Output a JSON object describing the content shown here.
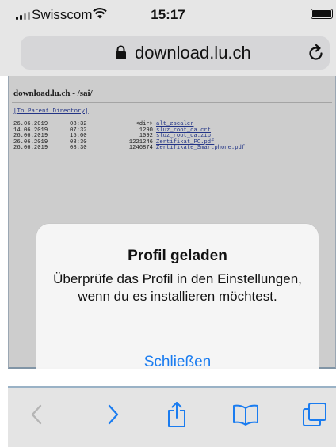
{
  "status_bar": {
    "carrier": "Swisscom",
    "time": "15:17",
    "icons": [
      "signal-icon",
      "wifi-icon",
      "battery-icon"
    ]
  },
  "url_bar": {
    "domain": "download.lu.ch",
    "icons": [
      "lock-icon",
      "reload-icon"
    ]
  },
  "page": {
    "heading": "download.lu.ch - /sai/",
    "parent_link": "[To Parent Directory]",
    "entries": [
      {
        "date": "26.06.2019",
        "time": "08:32",
        "size": "<dir>",
        "name": "alt_zscaler"
      },
      {
        "date": "14.06.2019",
        "time": "07:32",
        "size": "1290",
        "name": "sluz_root_ca.crt"
      },
      {
        "date": "26.06.2019",
        "time": "15:00",
        "size": "1092",
        "name": "sluz_root_ca.zip"
      },
      {
        "date": "26.06.2019",
        "time": "08:30",
        "size": "1221246",
        "name": "Zertifikat_PC.pdf"
      },
      {
        "date": "26.06.2019",
        "time": "08:30",
        "size": "1246874",
        "name": "Zertifikate_Smartphone.pdf"
      }
    ]
  },
  "alert": {
    "title": "Profil geladen",
    "message": "Überprüfe das Profil in den Einstellungen, wenn du es installieren möchtest.",
    "button": "Schließen"
  },
  "toolbar": {
    "items": [
      "back-icon",
      "forward-icon",
      "share-icon",
      "bookmarks-icon",
      "tabs-icon"
    ]
  },
  "colors": {
    "accent": "#1a7cf0",
    "link": "#2a3fa0",
    "chrome": "#e6e6e6",
    "disabled": "#b5b5b5"
  }
}
